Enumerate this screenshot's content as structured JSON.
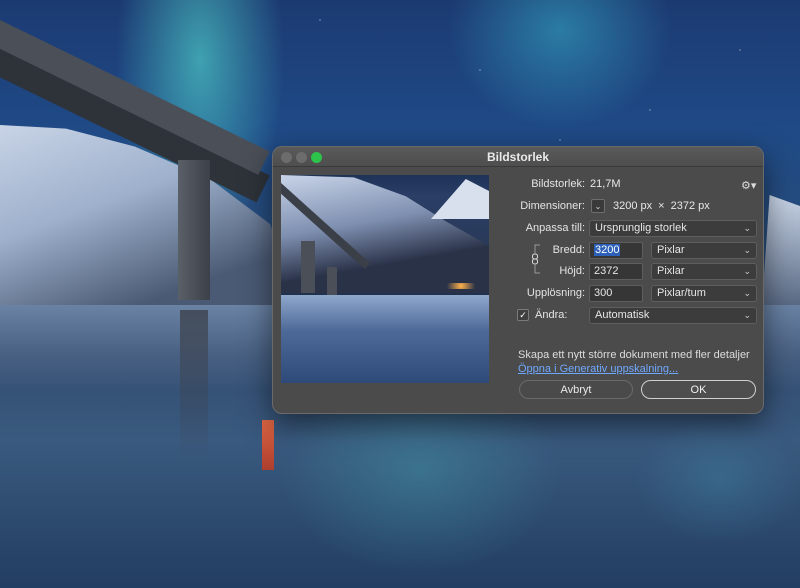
{
  "dialog": {
    "title": "Bildstorlek",
    "image_size_label": "Bildstorlek:",
    "image_size_value": "21,7M",
    "dimensions_label": "Dimensioner:",
    "dimensions_width": "3200 px",
    "dimensions_sep": "×",
    "dimensions_height": "2372 px",
    "fit_label": "Anpassa till:",
    "fit_value": "Ursprunglig storlek",
    "width_label": "Bredd:",
    "width_value": "3200",
    "width_unit": "Pixlar",
    "height_label": "Höjd:",
    "height_value": "2372",
    "height_unit": "Pixlar",
    "resolution_label": "Upplösning:",
    "resolution_value": "300",
    "resolution_unit": "Pixlar/tum",
    "resample_label": "Ändra:",
    "resample_checked": true,
    "resample_value": "Automatisk",
    "info_text": "Skapa ett nytt större dokument med fler detaljer",
    "info_link": "Öppna i Generativ uppskalning...",
    "cancel_label": "Avbryt",
    "ok_label": "OK"
  },
  "icons": {
    "gear": "gear-icon",
    "link": "link-icon",
    "chevron": "chevron-down-icon",
    "check": "checkmark-icon"
  },
  "colors": {
    "dialog_bg": "#4b4b4b",
    "link": "#6fa8ff",
    "selection": "#2c5fb8",
    "maximize": "#2ec34a"
  }
}
